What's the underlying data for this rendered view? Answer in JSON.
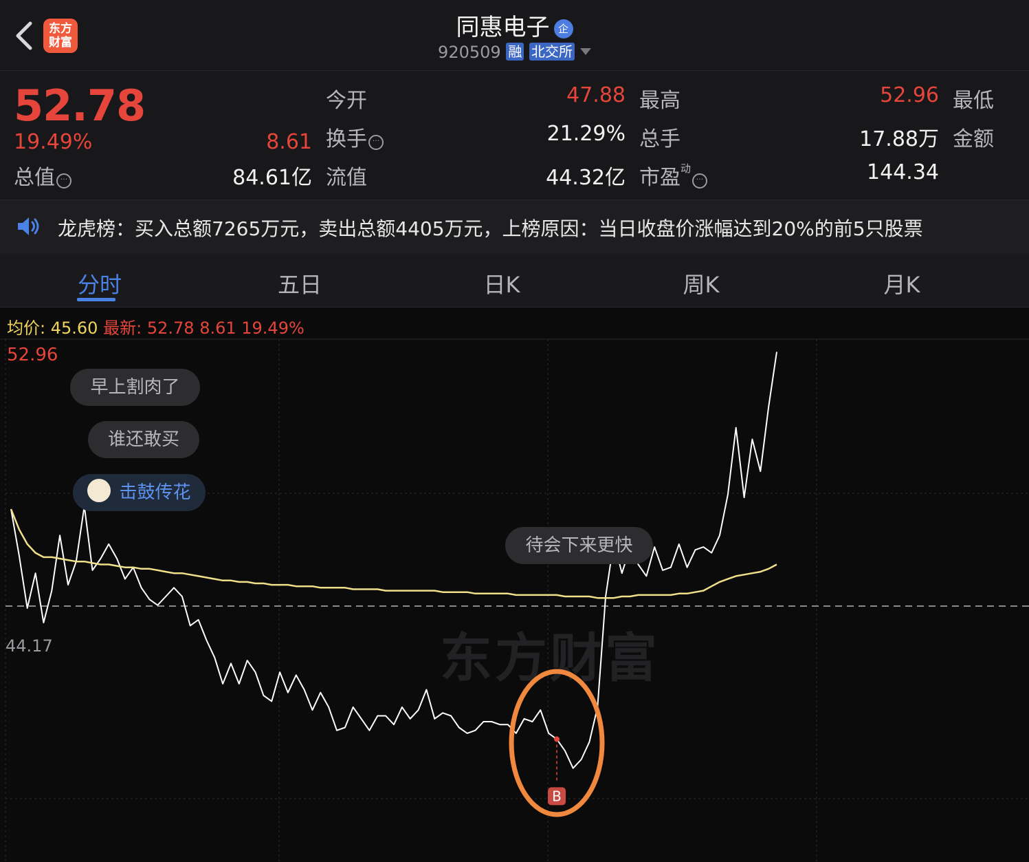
{
  "header": {
    "logo_line1": "东方",
    "logo_line2": "财富",
    "stock_name": "同惠电子",
    "ent_badge": "企",
    "stock_code": "920509",
    "margin_tag": "融",
    "exchange_tag": "北交所"
  },
  "quote": {
    "price": "52.78",
    "change_pct": "19.49%",
    "change": "8.61",
    "open_label": "今开",
    "open": "47.88",
    "high_label": "最高",
    "high": "52.96",
    "low_label": "最低",
    "turnover_label": "换手",
    "turnover": "21.29%",
    "volume_label": "总手",
    "volume": "17.88万",
    "amount_label": "金额",
    "mktcap_label": "总值",
    "mktcap": "84.61亿",
    "float_label": "流值",
    "float": "44.32亿",
    "pe_label": "市盈",
    "pe_sup": "动",
    "pe": "144.34"
  },
  "news": {
    "text": "龙虎榜：买入总额7265万元，卖出总额4405万元，上榜原因：当日收盘价涨幅达到20%的前5只股票"
  },
  "tabs": [
    "分时",
    "五日",
    "日K",
    "周K",
    "月K"
  ],
  "active_tab": 0,
  "legend": {
    "avg_label": "均价:",
    "avg": "45.60",
    "latest_label": "最新:",
    "latest": "52.78",
    "latest_chg": "8.61",
    "latest_pct": "19.49%"
  },
  "axis": {
    "top": "52.96",
    "prev_close": "44.17"
  },
  "bubbles": [
    "早上割肉了",
    "谁还敢买",
    "击鼓传花",
    "待会下来更快"
  ],
  "marker_label": "B",
  "watermark": "东方财富",
  "colors": {
    "up": "#e5453a",
    "price_line": "#ffffff",
    "avg_line": "#f0e08a",
    "accent": "#4a82e8",
    "highlight": "#f0883e"
  },
  "chart_data": {
    "type": "line",
    "prev_close": 44.17,
    "ylim": [
      35.38,
      52.96
    ],
    "series": [
      {
        "name": "price",
        "values": [
          47.5,
          45.9,
          44.1,
          45.3,
          43.6,
          44.7,
          46.6,
          44.9,
          45.7,
          47.6,
          45.4,
          45.8,
          46.3,
          45.8,
          45.1,
          45.5,
          44.8,
          44.4,
          44.2,
          44.5,
          44.8,
          44.5,
          43.5,
          43.7,
          43.0,
          42.4,
          41.5,
          42.2,
          41.5,
          42.3,
          41.9,
          41.1,
          40.9,
          41.9,
          41.2,
          41.8,
          41.3,
          40.6,
          41.2,
          40.7,
          39.9,
          40.0,
          40.7,
          40.3,
          39.9,
          40.4,
          40.4,
          40.1,
          40.7,
          40.3,
          40.6,
          41.3,
          40.3,
          40.5,
          40.4,
          40.0,
          39.8,
          39.9,
          40.2,
          40.2,
          40.1,
          40.1,
          39.8,
          40.3,
          40.2,
          40.6,
          39.8,
          39.6,
          39.2,
          38.6,
          38.9,
          39.5,
          40.7,
          44.5,
          46.4,
          45.3,
          46.2,
          45.6,
          45.2,
          46.2,
          45.4,
          45.5,
          46.3,
          45.5,
          46.1,
          46.2,
          46.0,
          46.6,
          48.0,
          50.3,
          47.9,
          49.9,
          48.8,
          51.0,
          52.9
        ],
        "color": "#ffffff"
      },
      {
        "name": "avg",
        "values": [
          47.5,
          46.8,
          46.3,
          46.0,
          45.85,
          45.85,
          45.8,
          45.75,
          45.7,
          45.7,
          45.65,
          45.6,
          45.6,
          45.55,
          45.5,
          45.5,
          45.45,
          45.45,
          45.4,
          45.35,
          45.3,
          45.3,
          45.25,
          45.2,
          45.15,
          45.1,
          45.05,
          45.05,
          45.0,
          45.0,
          44.95,
          44.95,
          44.9,
          44.9,
          44.9,
          44.85,
          44.85,
          44.85,
          44.8,
          44.8,
          44.8,
          44.8,
          44.75,
          44.75,
          44.75,
          44.75,
          44.7,
          44.7,
          44.7,
          44.7,
          44.7,
          44.7,
          44.7,
          44.65,
          44.65,
          44.65,
          44.65,
          44.6,
          44.6,
          44.6,
          44.6,
          44.6,
          44.55,
          44.55,
          44.55,
          44.55,
          44.55,
          44.55,
          44.5,
          44.5,
          44.5,
          44.5,
          44.45,
          44.45,
          44.45,
          44.5,
          44.5,
          44.55,
          44.55,
          44.55,
          44.55,
          44.55,
          44.6,
          44.6,
          44.65,
          44.7,
          44.85,
          45.0,
          45.1,
          45.2,
          45.25,
          45.3,
          45.35,
          45.45,
          45.6
        ],
        "color": "#f0e08a"
      }
    ]
  }
}
